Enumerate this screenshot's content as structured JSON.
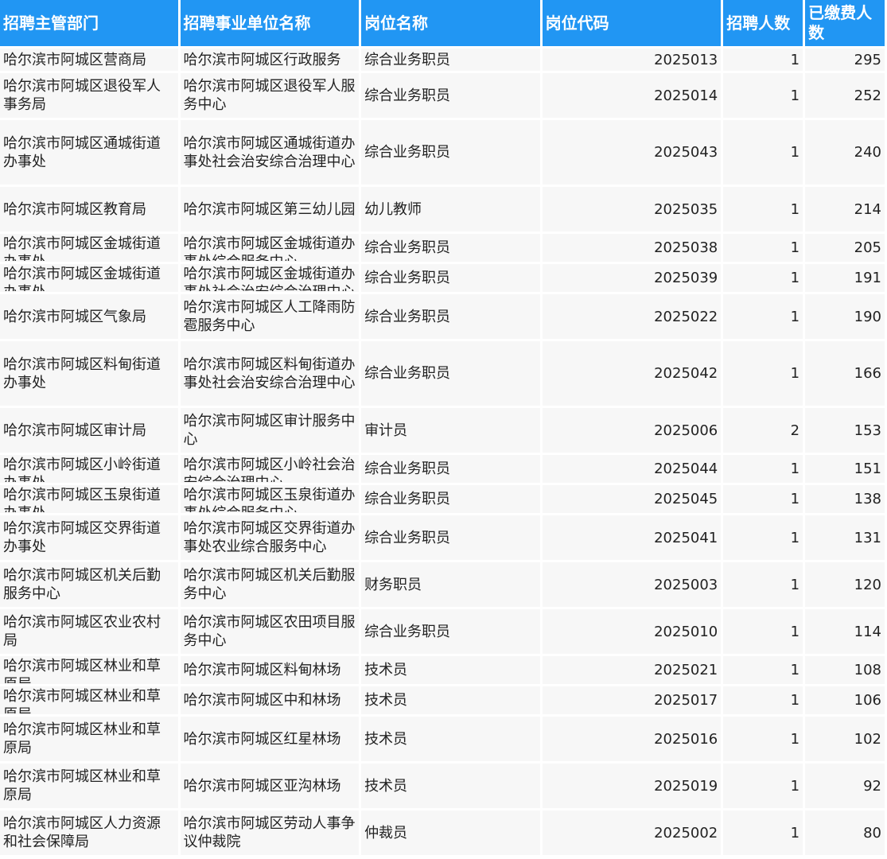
{
  "headers": {
    "dept": "招聘主管部门",
    "unit": "招聘事业单位名称",
    "post": "岗位名称",
    "code": "岗位代码",
    "count": "招聘人数",
    "paid": "已缴费人数"
  },
  "rows": [
    {
      "dept": "哈尔滨市阿城区营商局",
      "unit": "哈尔滨市阿城区行政服务",
      "post": "综合业务职员",
      "code": "2025013",
      "count": "1",
      "paid": "295"
    },
    {
      "dept": "哈尔滨市阿城区退役军人事务局",
      "unit": "哈尔滨市阿城区退役军人服务中心",
      "post": "综合业务职员",
      "code": "2025014",
      "count": "1",
      "paid": "252"
    },
    {
      "dept": "哈尔滨市阿城区通城街道办事处",
      "unit": "哈尔滨市阿城区通城街道办事处社会治安综合治理中心",
      "post": "综合业务职员",
      "code": "2025043",
      "count": "1",
      "paid": "240"
    },
    {
      "dept": "哈尔滨市阿城区教育局",
      "unit": "哈尔滨市阿城区第三幼儿园",
      "post": "幼儿教师",
      "code": "2025035",
      "count": "1",
      "paid": "214"
    },
    {
      "dept": "哈尔滨市阿城区金城街道办事处",
      "unit": "哈尔滨市阿城区金城街道办事处综合服务中心",
      "post": "综合业务职员",
      "code": "2025038",
      "count": "1",
      "paid": "205"
    },
    {
      "dept": "哈尔滨市阿城区金城街道办事处",
      "unit": "哈尔滨市阿城区金城街道办事处社会治安综合治理中心",
      "post": "综合业务职员",
      "code": "2025039",
      "count": "1",
      "paid": "191"
    },
    {
      "dept": "哈尔滨市阿城区气象局",
      "unit": "哈尔滨市阿城区人工降雨防雹服务中心",
      "post": "综合业务职员",
      "code": "2025022",
      "count": "1",
      "paid": "190"
    },
    {
      "dept": "哈尔滨市阿城区料甸街道办事处",
      "unit": "哈尔滨市阿城区料甸街道办事处社会治安综合治理中心",
      "post": "综合业务职员",
      "code": "2025042",
      "count": "1",
      "paid": "166"
    },
    {
      "dept": "哈尔滨市阿城区审计局",
      "unit": "哈尔滨市阿城区审计服务中心",
      "post": "审计员",
      "code": "2025006",
      "count": "2",
      "paid": "153"
    },
    {
      "dept": "哈尔滨市阿城区小岭街道办事处",
      "unit": "哈尔滨市阿城区小岭社会治安综合治理中心",
      "post": "综合业务职员",
      "code": "2025044",
      "count": "1",
      "paid": "151"
    },
    {
      "dept": "哈尔滨市阿城区玉泉街道办事处",
      "unit": "哈尔滨市阿城区玉泉街道办事处综合服务中心",
      "post": "综合业务职员",
      "code": "2025045",
      "count": "1",
      "paid": "138"
    },
    {
      "dept": "哈尔滨市阿城区交界街道办事处",
      "unit": "哈尔滨市阿城区交界街道办事处农业综合服务中心",
      "post": "综合业务职员",
      "code": "2025041",
      "count": "1",
      "paid": "131"
    },
    {
      "dept": "哈尔滨市阿城区机关后勤服务中心",
      "unit": "哈尔滨市阿城区机关后勤服务中心",
      "post": "财务职员",
      "code": "2025003",
      "count": "1",
      "paid": "120"
    },
    {
      "dept": "哈尔滨市阿城区农业农村局",
      "unit": "哈尔滨市阿城区农田项目服务中心",
      "post": "综合业务职员",
      "code": "2025010",
      "count": "1",
      "paid": "114"
    },
    {
      "dept": "哈尔滨市阿城区林业和草原局",
      "unit": "哈尔滨市阿城区料甸林场",
      "post": "技术员",
      "code": "2025021",
      "count": "1",
      "paid": "108"
    },
    {
      "dept": "哈尔滨市阿城区林业和草原局",
      "unit": "哈尔滨市阿城区中和林场",
      "post": "技术员",
      "code": "2025017",
      "count": "1",
      "paid": "106"
    },
    {
      "dept": "哈尔滨市阿城区林业和草原局",
      "unit": "哈尔滨市阿城区红星林场",
      "post": "技术员",
      "code": "2025016",
      "count": "1",
      "paid": "102"
    },
    {
      "dept": "哈尔滨市阿城区林业和草原局",
      "unit": "哈尔滨市阿城区亚沟林场",
      "post": "技术员",
      "code": "2025019",
      "count": "1",
      "paid": "92"
    },
    {
      "dept": "哈尔滨市阿城区人力资源和社会保障局",
      "unit": "哈尔滨市阿城区劳动人事争议仲裁院",
      "post": "仲裁员",
      "code": "2025002",
      "count": "1",
      "paid": "80"
    }
  ]
}
